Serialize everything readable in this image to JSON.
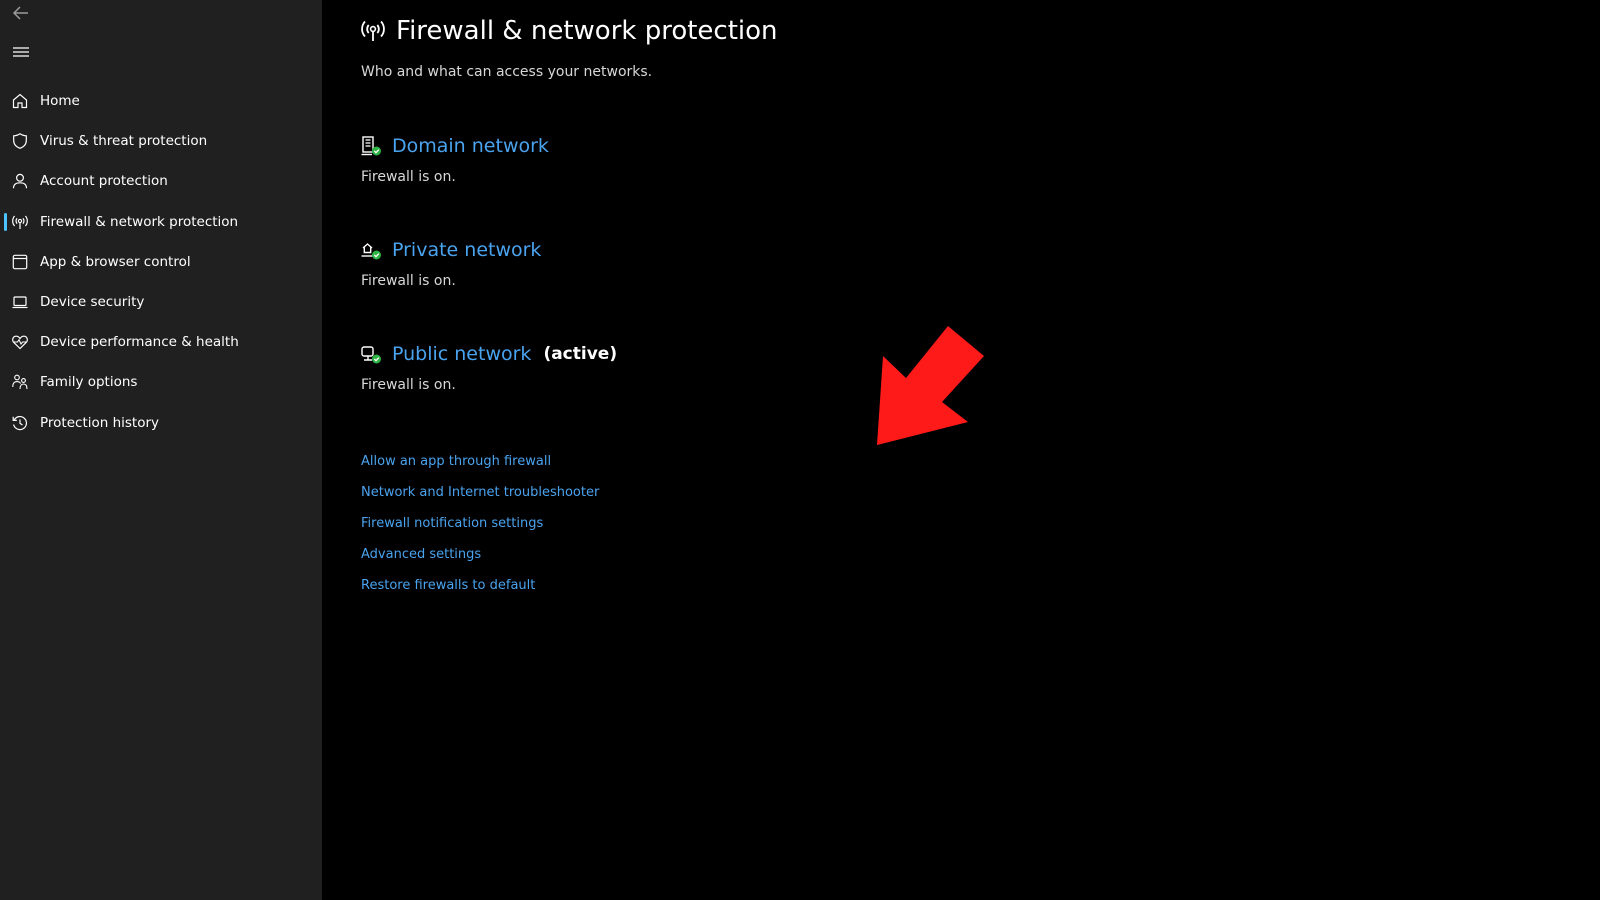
{
  "nav": {
    "back_icon": "back-arrow-icon",
    "menu_icon": "hamburger-menu-icon",
    "items": [
      {
        "label": "Home",
        "icon": "home-icon"
      },
      {
        "label": "Virus & threat protection",
        "icon": "shield-icon"
      },
      {
        "label": "Account protection",
        "icon": "person-icon"
      },
      {
        "label": "Firewall & network protection",
        "icon": "wireless-antenna-icon"
      },
      {
        "label": "App & browser control",
        "icon": "app-window-icon"
      },
      {
        "label": "Device security",
        "icon": "laptop-icon"
      },
      {
        "label": "Device performance & health",
        "icon": "heart-pulse-icon"
      },
      {
        "label": "Family options",
        "icon": "family-icon"
      },
      {
        "label": "Protection history",
        "icon": "history-icon"
      }
    ],
    "active_index": 3
  },
  "page": {
    "title": "Firewall & network protection",
    "subtitle": "Who and what can access your networks.",
    "icon": "wireless-antenna-icon"
  },
  "networks": [
    {
      "name": "Domain network",
      "status": "Firewall is on.",
      "active_label": "",
      "icon": "domain-network-icon"
    },
    {
      "name": "Private network",
      "status": "Firewall is on.",
      "active_label": "",
      "icon": "private-network-icon"
    },
    {
      "name": "Public network",
      "status": "Firewall is on.",
      "active_label": "(active)",
      "icon": "public-network-icon"
    }
  ],
  "links": [
    "Allow an app through firewall",
    "Network and Internet troubleshooter",
    "Firewall notification settings",
    "Advanced settings",
    "Restore firewalls to default"
  ],
  "colors": {
    "sidebar_bg": "#202020",
    "main_bg": "#000000",
    "link": "#4aa3ee",
    "accent_indicator": "#4cc2ff",
    "status_check": "#2fb344",
    "annotation_arrow": "#ff1a1a"
  }
}
